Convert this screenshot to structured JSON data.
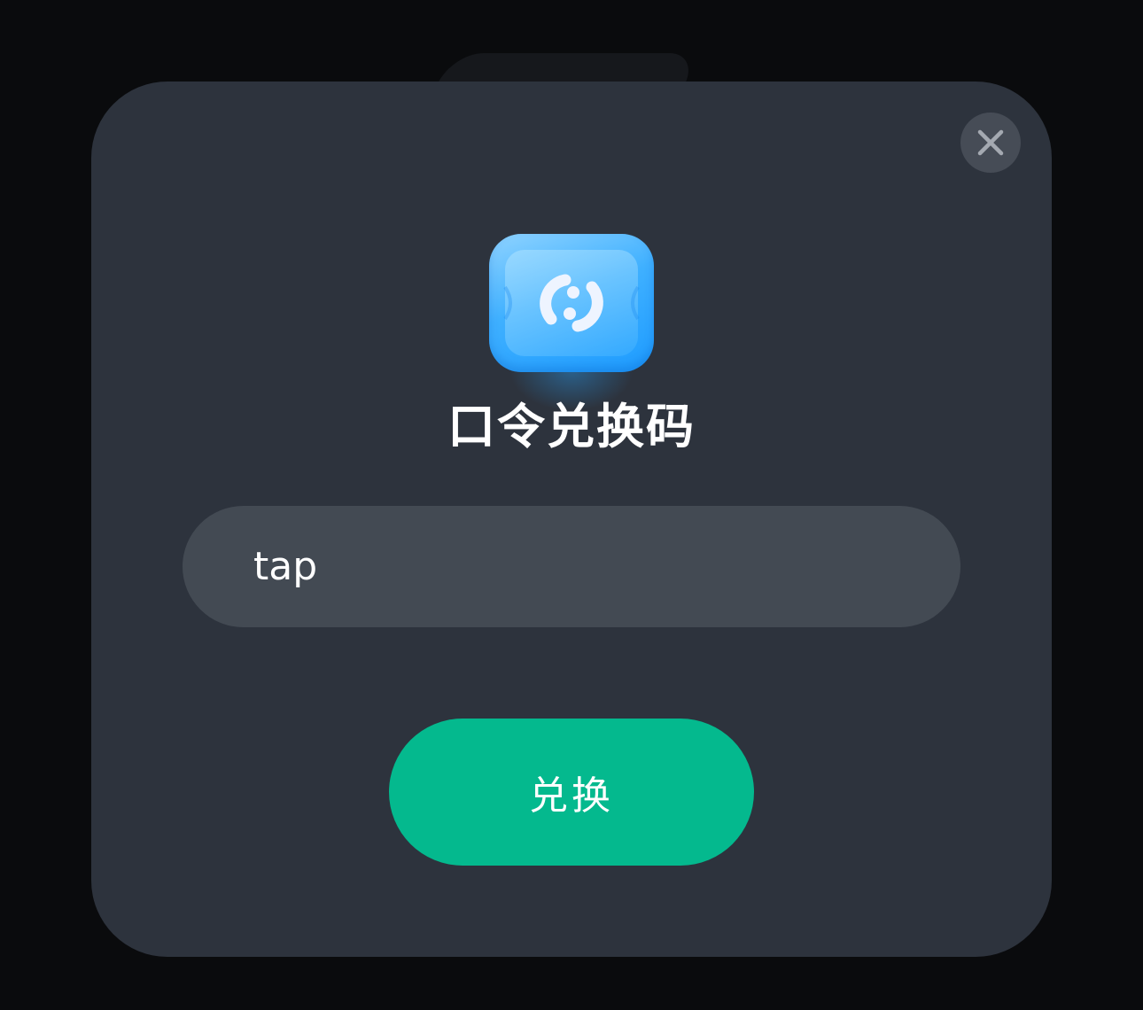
{
  "dialog": {
    "title": "口令兑换码",
    "close_icon": "close-icon",
    "app_icon": "redeem-ticket-icon",
    "input": {
      "value": "tap",
      "placeholder": ""
    },
    "redeem_label": "兑换"
  },
  "colors": {
    "backdrop": "#0a0b0d",
    "dialog": "#2d333d",
    "input": "#434a53",
    "button": "#04b98e",
    "close": "#464c56",
    "icon_blue": "#2fa8ff"
  }
}
